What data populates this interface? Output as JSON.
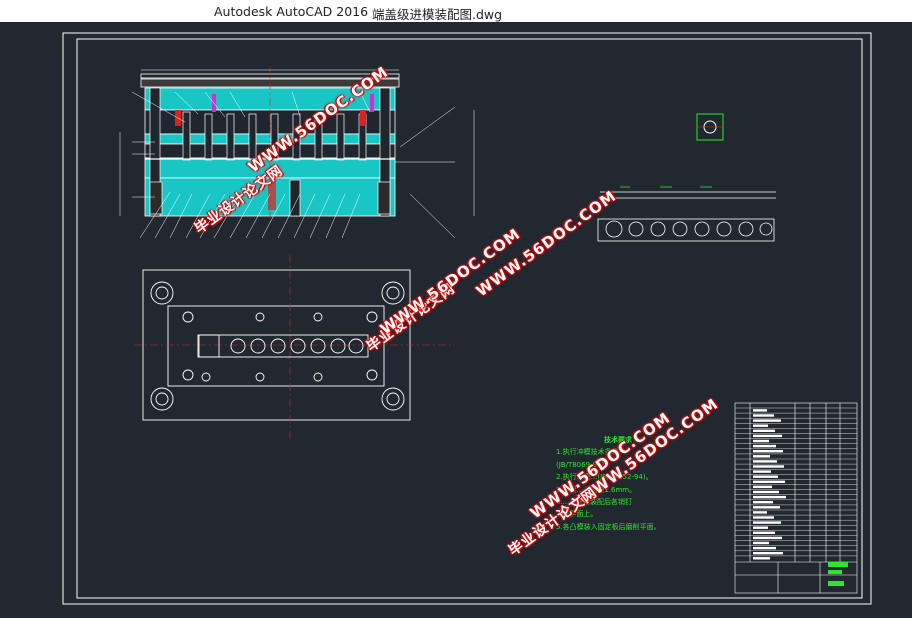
{
  "titlebar": {
    "app_name": "Autodesk AutoCAD 2016",
    "file_name": "端盖级进模装配图.dwg"
  },
  "watermarks": {
    "url": "WWW.56DOC.COM",
    "site_name": "毕业设计论文网"
  },
  "tech_requirements": {
    "heading": "技术要求",
    "items": [
      "1.执行冲模技术条件",
      "(JB/T8069-95)。",
      "2.执行冲模...(JB/T7652-94)。",
      "3.模架...入到模1.6mm。",
      "4.......升模装配后各销钉",
      "......平面上。",
      "5.各凸模装入固定板后磨削平面。"
    ]
  },
  "colors": {
    "canvas_bg": "#212830",
    "lines": "#ffffff",
    "cyan": "#19c6c6",
    "red": "#e02020",
    "green": "#2ee62e",
    "magenta": "#d030d0"
  }
}
